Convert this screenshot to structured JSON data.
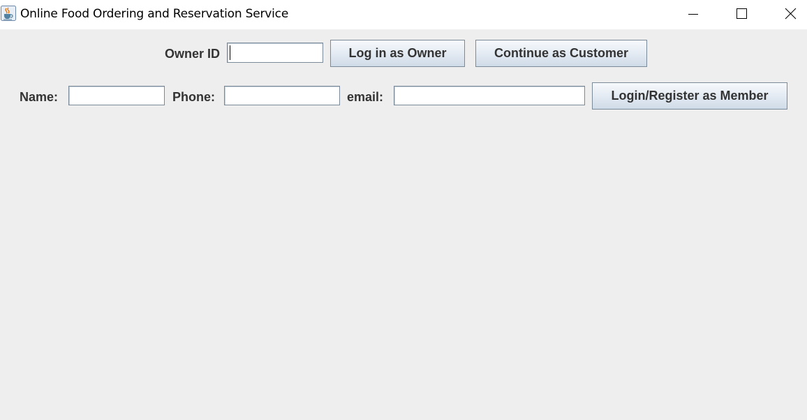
{
  "window": {
    "title": "Online Food Ordering and Reservation Service",
    "app_icon": "java-cup-icon",
    "controls": [
      "minimize-icon",
      "maximize-icon",
      "close-icon"
    ]
  },
  "owner_row": {
    "owner_id_label": "Owner ID",
    "owner_id_value": "",
    "login_owner_button": "Log in as Owner",
    "continue_customer_button": "Continue as Customer"
  },
  "member_row": {
    "name_label": "Name:",
    "name_value": "",
    "phone_label": "Phone:",
    "phone_value": "",
    "email_label": "email:",
    "email_value": "",
    "login_member_button": "Login/Register as Member"
  },
  "colors": {
    "background": "#eeeeee",
    "titlebar": "#ffffff",
    "label_text": "#333333",
    "button_border": "#7a8a99"
  }
}
